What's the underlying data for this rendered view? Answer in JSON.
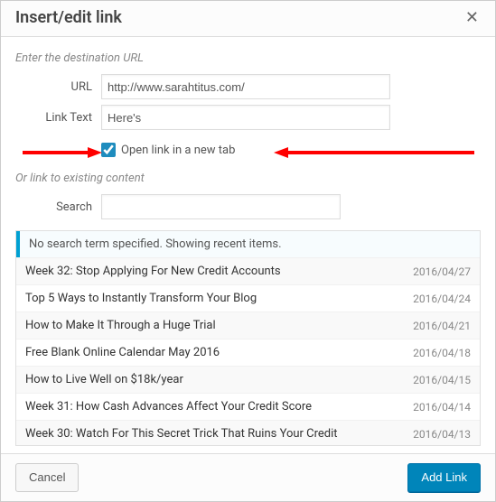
{
  "dialog": {
    "title": "Insert/edit link",
    "section_dest": "Enter the destination URL",
    "url_label": "URL",
    "url_value": "http://www.sarahtitus.com/",
    "text_label": "Link Text",
    "text_value": "Here's",
    "newtab_label": "Open link in a new tab",
    "section_existing": "Or link to existing content",
    "search_label": "Search",
    "search_value": "",
    "notice": "No search term specified. Showing recent items.",
    "cancel": "Cancel",
    "submit": "Add Link"
  },
  "results": [
    {
      "title": "Week 32: Stop Applying For New Credit Accounts",
      "date": "2016/04/27"
    },
    {
      "title": "Top 5 Ways to Instantly Transform Your Blog",
      "date": "2016/04/24"
    },
    {
      "title": "How to Make It Through a Huge Trial",
      "date": "2016/04/21"
    },
    {
      "title": "Free Blank Online Calendar May 2016",
      "date": "2016/04/18"
    },
    {
      "title": "How to Live Well on $18k/year",
      "date": "2016/04/15"
    },
    {
      "title": "Week 31: How Cash Advances Affect Your Credit Score",
      "date": "2016/04/14"
    },
    {
      "title": "Week 30: Watch For This Secret Trick That Ruins Your Credit",
      "date": "2016/04/13"
    }
  ]
}
